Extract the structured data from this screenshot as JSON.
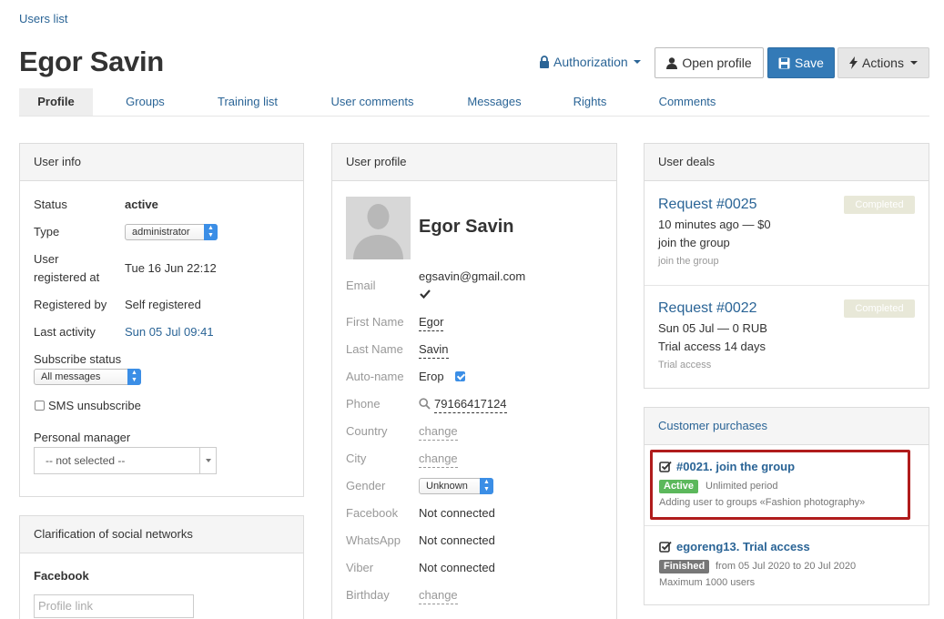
{
  "breadcrumb": "Users list",
  "title": "Egor Savin",
  "header": {
    "authorization": "Authorization",
    "open_profile": "Open profile",
    "save": "Save",
    "actions": "Actions"
  },
  "tabs": [
    "Profile",
    "Groups",
    "Training list",
    "User comments",
    "Messages",
    "Rights",
    "Comments"
  ],
  "user_info": {
    "title": "User info",
    "status_label": "Status",
    "status_value": "active",
    "type_label": "Type",
    "type_value": "administrator",
    "registered_label_1": "User",
    "registered_label_2": "registered at",
    "registered_value": "Tue 16 Jun 22:12",
    "registered_by_label": "Registered by",
    "registered_by_value": "Self registered",
    "last_activity_label": "Last activity",
    "last_activity_value": "Sun 05 Jul 09:41",
    "subscribe_label": "Subscribe status",
    "subscribe_value": "All messages",
    "sms_label": "SMS unsubscribe",
    "manager_label": "Personal manager",
    "manager_value": "-- not selected --"
  },
  "social": {
    "title": "Clarification of social networks",
    "facebook_label": "Facebook",
    "profile_link_placeholder": "Profile link"
  },
  "user_profile": {
    "title": "User profile",
    "name": "Egor Savin",
    "email_label": "Email",
    "email_value": "egsavin@gmail.com",
    "first_name_label": "First Name",
    "first_name_value": "Egor",
    "last_name_label": "Last Name",
    "last_name_value": "Savin",
    "auto_name_label": "Auto-name",
    "auto_name_value": "Егор",
    "phone_label": "Phone",
    "phone_value": "79166417124",
    "country_label": "Country",
    "country_value": "change",
    "city_label": "City",
    "city_value": "change",
    "gender_label": "Gender",
    "gender_value": "Unknown",
    "facebook_label": "Facebook",
    "facebook_value": "Not connected",
    "whatsapp_label": "WhatsApp",
    "whatsapp_value": "Not connected",
    "viber_label": "Viber",
    "viber_value": "Not connected",
    "birthday_label": "Birthday",
    "birthday_value": "change"
  },
  "deals": {
    "title": "User deals",
    "items": [
      {
        "link": "Request #0025",
        "line1": "10 minutes ago — $0",
        "line2": "join the group",
        "small": "join the group",
        "badge": "Completed"
      },
      {
        "link": "Request #0022",
        "line1": "Sun 05 Jul — 0 RUB",
        "line2": "Trial access 14 days",
        "small": "Trial access",
        "badge": "Completed"
      }
    ]
  },
  "purchases": {
    "title": "Customer purchases",
    "items": [
      {
        "title": "#0021. join the group",
        "badge": "Active",
        "period": "Unlimited period",
        "desc": "Adding user to groups «Fashion photography»"
      },
      {
        "title": "egoreng13. Trial access",
        "badge": "Finished",
        "period": "from 05 Jul 2020 to 20 Jul 2020",
        "desc": "Maximum 1000 users"
      }
    ]
  },
  "colors": {
    "accent": "#337ab7",
    "link": "#2a6496",
    "active_badge": "#5cb85c",
    "highlight": "#b01c1c"
  }
}
